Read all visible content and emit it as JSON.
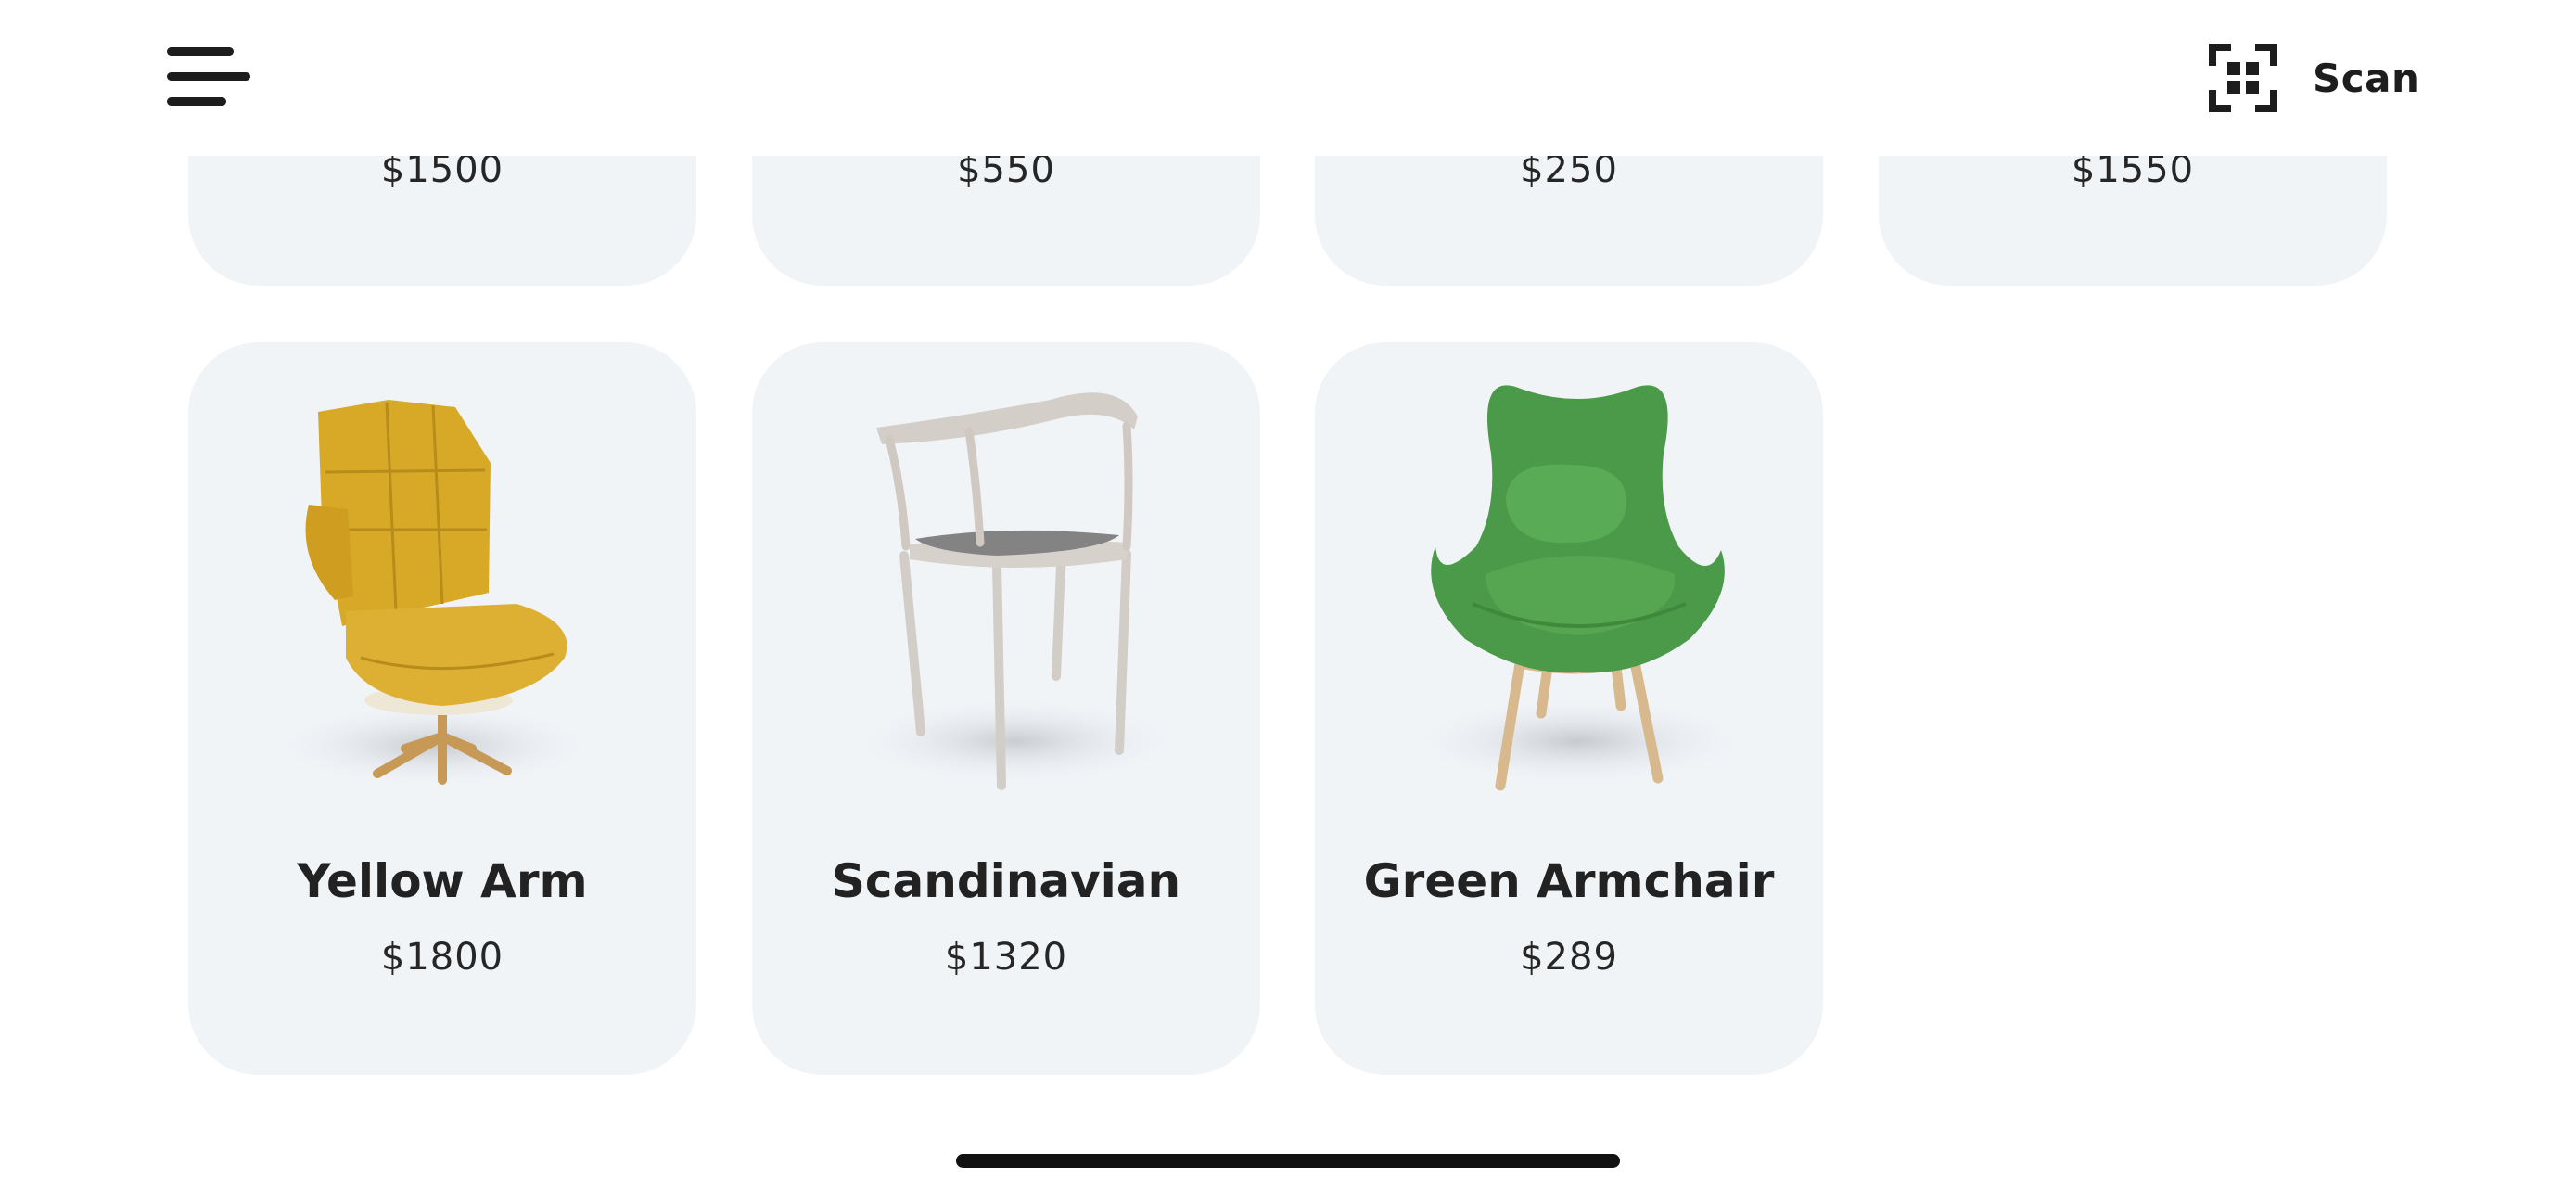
{
  "header": {
    "menu_icon": "hamburger-menu-icon",
    "scan_icon": "scan-qr-icon",
    "scan_label": "Scan"
  },
  "previous_row": [
    {
      "price": "$1500"
    },
    {
      "price": "$550"
    },
    {
      "price": "$250"
    },
    {
      "price": "$1550"
    }
  ],
  "products": [
    {
      "name": "Yellow Arm",
      "price": "$1800",
      "image": "yellow-lounge-chair",
      "color": "#d8a827"
    },
    {
      "name": "Scandinavian",
      "price": "$1320",
      "image": "scandinavian-wood-chair",
      "color": "#cfc8c1"
    },
    {
      "name": "Green Armchair",
      "price": "$289",
      "image": "green-armchair",
      "color": "#4b9a49"
    }
  ],
  "colors": {
    "card_background": "#f1f4f7",
    "text_primary": "#222222",
    "home_indicator": "#111111"
  }
}
